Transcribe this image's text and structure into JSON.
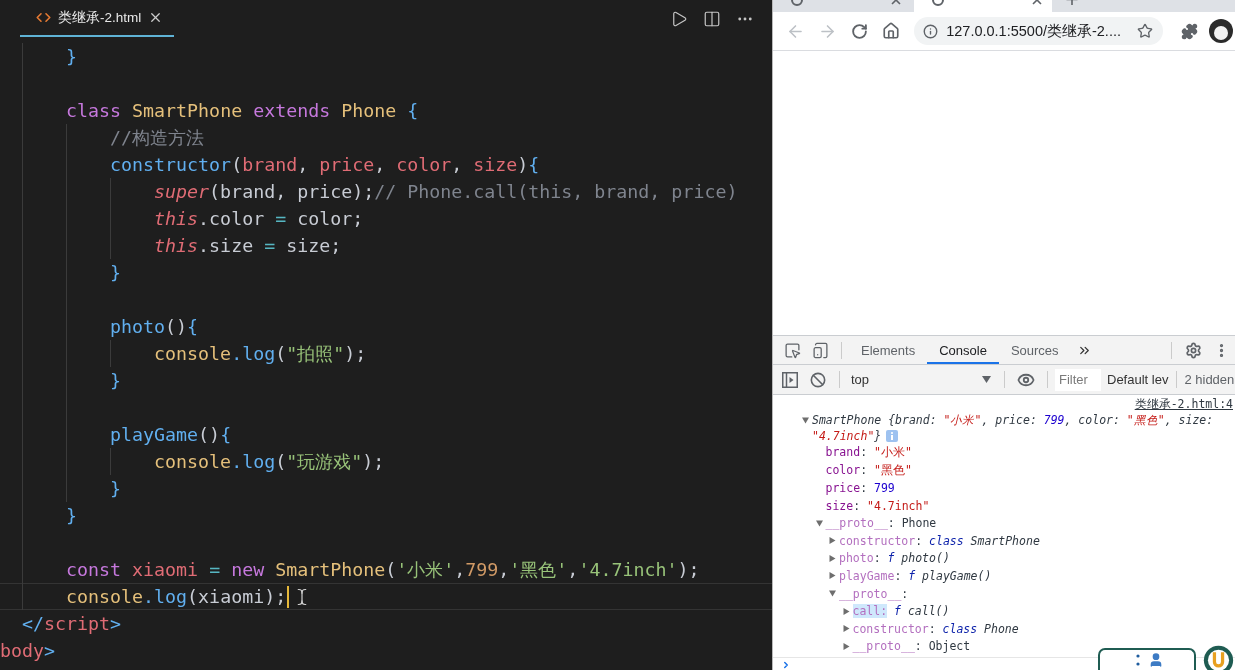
{
  "editor": {
    "tabs": [
      {
        "label": "类继承-2.html",
        "selected": true
      }
    ],
    "lines": [
      {
        "kind": "group",
        "children": [
          {
            "kind": "group",
            "children": [
              {
                "kind": "code",
                "cursor": false,
                "tokens": [
                  {
                    "kind": "bracket",
                    "text": "}"
                  }
                ]
              },
              {
                "kind": "blank",
                "cursor": false
              },
              {
                "kind": "code",
                "cursor": false,
                "tokens": [
                  {
                    "kind": "keyword",
                    "text": "class "
                  },
                  {
                    "kind": "class",
                    "text": "SmartPhone "
                  },
                  {
                    "kind": "keyword",
                    "text": "extends "
                  },
                  {
                    "kind": "class",
                    "text": "Phone "
                  },
                  {
                    "kind": "bracket",
                    "text": "{"
                  }
                ],
                "children": [
                  {
                    "kind": "code",
                    "cursor": false,
                    "tokens": [
                      {
                        "kind": "comment",
                        "text": "//构造方法"
                      }
                    ]
                  },
                  {
                    "kind": "code",
                    "cursor": false,
                    "tokens": [
                      {
                        "kind": "function",
                        "text": "constructor"
                      },
                      {
                        "kind": "plain",
                        "text": "("
                      },
                      {
                        "kind": "variable",
                        "text": "brand"
                      },
                      {
                        "kind": "plain",
                        "text": ", "
                      },
                      {
                        "kind": "variable",
                        "text": "price"
                      },
                      {
                        "kind": "plain",
                        "text": ", "
                      },
                      {
                        "kind": "variable",
                        "text": "color"
                      },
                      {
                        "kind": "plain",
                        "text": ", "
                      },
                      {
                        "kind": "variable",
                        "text": "size"
                      },
                      {
                        "kind": "plain",
                        "text": ")"
                      },
                      {
                        "kind": "bracket",
                        "text": "{"
                      }
                    ],
                    "children": [
                      {
                        "kind": "code",
                        "cursor": false,
                        "tokens": [
                          {
                            "kind": "builtin",
                            "text": "super"
                          },
                          {
                            "kind": "plain",
                            "text": "(brand, price);"
                          },
                          {
                            "kind": "comment",
                            "text": "// Phone.call(this, brand, price)"
                          }
                        ]
                      },
                      {
                        "kind": "code",
                        "cursor": false,
                        "tokens": [
                          {
                            "kind": "builtin",
                            "text": "this"
                          },
                          {
                            "kind": "plain",
                            "text": ".color "
                          },
                          {
                            "kind": "operator",
                            "text": "="
                          },
                          {
                            "kind": "plain",
                            "text": " color;"
                          }
                        ]
                      },
                      {
                        "kind": "code",
                        "cursor": false,
                        "tokens": [
                          {
                            "kind": "builtin",
                            "text": "this"
                          },
                          {
                            "kind": "plain",
                            "text": ".size "
                          },
                          {
                            "kind": "operator",
                            "text": "="
                          },
                          {
                            "kind": "plain",
                            "text": " size;"
                          }
                        ]
                      }
                    ]
                  },
                  {
                    "kind": "code",
                    "cursor": false,
                    "tokens": [
                      {
                        "kind": "bracket",
                        "text": "}"
                      }
                    ]
                  },
                  {
                    "kind": "blank",
                    "cursor": false
                  },
                  {
                    "kind": "code",
                    "cursor": false,
                    "tokens": [
                      {
                        "kind": "function",
                        "text": "photo"
                      },
                      {
                        "kind": "plain",
                        "text": "()"
                      },
                      {
                        "kind": "bracket",
                        "text": "{"
                      }
                    ],
                    "children": [
                      {
                        "kind": "code",
                        "cursor": false,
                        "tokens": [
                          {
                            "kind": "class",
                            "text": "console"
                          },
                          {
                            "kind": "function",
                            "text": ".log"
                          },
                          {
                            "kind": "plain",
                            "text": "("
                          },
                          {
                            "kind": "string",
                            "text": "\"拍照\""
                          },
                          {
                            "kind": "plain",
                            "text": ");"
                          }
                        ]
                      }
                    ]
                  },
                  {
                    "kind": "code",
                    "cursor": false,
                    "tokens": [
                      {
                        "kind": "bracket",
                        "text": "}"
                      }
                    ]
                  },
                  {
                    "kind": "blank",
                    "cursor": false
                  },
                  {
                    "kind": "code",
                    "cursor": false,
                    "tokens": [
                      {
                        "kind": "function",
                        "text": "playGame"
                      },
                      {
                        "kind": "plain",
                        "text": "()"
                      },
                      {
                        "kind": "bracket",
                        "text": "{"
                      }
                    ],
                    "children": [
                      {
                        "kind": "code",
                        "cursor": false,
                        "tokens": [
                          {
                            "kind": "class",
                            "text": "console"
                          },
                          {
                            "kind": "function",
                            "text": ".log"
                          },
                          {
                            "kind": "plain",
                            "text": "("
                          },
                          {
                            "kind": "string",
                            "text": "\"玩游戏\""
                          },
                          {
                            "kind": "plain",
                            "text": ");"
                          }
                        ]
                      }
                    ]
                  },
                  {
                    "kind": "code",
                    "cursor": false,
                    "tokens": [
                      {
                        "kind": "bracket",
                        "text": "}"
                      }
                    ]
                  }
                ]
              },
              {
                "kind": "code",
                "cursor": false,
                "tokens": [
                  {
                    "kind": "bracket",
                    "text": "}"
                  }
                ]
              },
              {
                "kind": "blank",
                "cursor": false
              },
              {
                "kind": "code",
                "cursor": false,
                "tokens": [
                  {
                    "kind": "keyword",
                    "text": "const "
                  },
                  {
                    "kind": "variable",
                    "text": "xiaomi"
                  },
                  {
                    "kind": "operator",
                    "text": " = "
                  },
                  {
                    "kind": "keyword",
                    "text": "new "
                  },
                  {
                    "kind": "class",
                    "text": "SmartPhone"
                  },
                  {
                    "kind": "plain",
                    "text": "("
                  },
                  {
                    "kind": "string",
                    "text": "'小米'"
                  },
                  {
                    "kind": "plain",
                    "text": ","
                  },
                  {
                    "kind": "number",
                    "text": "799"
                  },
                  {
                    "kind": "plain",
                    "text": ","
                  },
                  {
                    "kind": "string",
                    "text": "'黑色'"
                  },
                  {
                    "kind": "plain",
                    "text": ","
                  },
                  {
                    "kind": "string",
                    "text": "'4.7inch'"
                  },
                  {
                    "kind": "plain",
                    "text": ");"
                  }
                ]
              },
              {
                "kind": "code",
                "cursor": true,
                "tokens": [
                  {
                    "kind": "class",
                    "text": "console"
                  },
                  {
                    "kind": "function",
                    "text": ".log"
                  },
                  {
                    "kind": "plain",
                    "text": "(xiaomi);"
                  }
                ]
              }
            ]
          },
          {
            "kind": "code",
            "cursor": false,
            "tokens": [
              {
                "kind": "tag-punct",
                "text": "</"
              },
              {
                "kind": "tag",
                "text": "script"
              },
              {
                "kind": "tag-punct",
                "text": ">"
              }
            ]
          }
        ]
      },
      {
        "kind": "code",
        "cursor": false,
        "tokens": [
          {
            "kind": "tag",
            "text": "body"
          },
          {
            "kind": "tag-punct",
            "text": ">"
          }
        ]
      }
    ]
  },
  "browser": {
    "tabs": [
      {
        "selected": false
      },
      {
        "selected": true
      }
    ],
    "back_button": {
      "disabled": true
    },
    "forward_button": {
      "disabled": true
    },
    "address": "127.0.0.1:5500/类继承-2...."
  },
  "devtools": {
    "tabs": [
      {
        "label": "Elements",
        "selected": false
      },
      {
        "label": "Console",
        "selected": true
      },
      {
        "label": "Sources",
        "selected": false
      }
    ],
    "context": "top",
    "filter": {
      "placeholder": "Filter"
    },
    "levels": "Default lev",
    "hidden": "2 hidden",
    "console": {
      "source_link": "类继承-2.html:4",
      "tree": {
        "kind": "branch",
        "expanded": true,
        "summary_lines": [
          [
            {
              "kind": "plain",
              "text": "SmartPhone {brand: "
            },
            {
              "kind": "string",
              "text": "\"小米\""
            },
            {
              "kind": "plain",
              "text": ", price: "
            },
            {
              "kind": "number",
              "text": "799"
            },
            {
              "kind": "plain",
              "text": ", color: "
            },
            {
              "kind": "string",
              "text": "\"黑色\""
            },
            {
              "kind": "plain",
              "text": ", size:"
            }
          ],
          [
            {
              "kind": "string",
              "text": "\"4.7inch\""
            },
            {
              "kind": "plain",
              "text": "}"
            }
          ]
        ],
        "children": [
          {
            "kind": "leaf",
            "tokens": [
              {
                "kind": "key",
                "text": "brand"
              },
              {
                "kind": "plain",
                "text": ": "
              },
              {
                "kind": "string",
                "text": "\"小米\""
              }
            ]
          },
          {
            "kind": "leaf",
            "tokens": [
              {
                "kind": "key",
                "text": "color"
              },
              {
                "kind": "plain",
                "text": ": "
              },
              {
                "kind": "string",
                "text": "\"黑色\""
              }
            ]
          },
          {
            "kind": "leaf",
            "tokens": [
              {
                "kind": "key",
                "text": "price"
              },
              {
                "kind": "plain",
                "text": ": "
              },
              {
                "kind": "number",
                "text": "799"
              }
            ]
          },
          {
            "kind": "leaf",
            "tokens": [
              {
                "kind": "key",
                "text": "size"
              },
              {
                "kind": "plain",
                "text": ": "
              },
              {
                "kind": "string",
                "text": "\"4.7inch\""
              }
            ]
          },
          {
            "kind": "branch",
            "expanded": true,
            "tokens": [
              {
                "kind": "proto-key",
                "text": "__proto__"
              },
              {
                "kind": "plain",
                "text": ": Phone"
              }
            ],
            "children": [
              {
                "kind": "branch",
                "expanded": false,
                "tokens": [
                  {
                    "kind": "proto-key",
                    "text": "constructor"
                  },
                  {
                    "kind": "plain",
                    "text": ": "
                  },
                  {
                    "kind": "keyword",
                    "text": "class"
                  },
                  {
                    "kind": "italic",
                    "text": " SmartPhone"
                  }
                ]
              },
              {
                "kind": "branch",
                "expanded": false,
                "tokens": [
                  {
                    "kind": "proto-key",
                    "text": "photo"
                  },
                  {
                    "kind": "plain",
                    "text": ": "
                  },
                  {
                    "kind": "keyword",
                    "text": "f"
                  },
                  {
                    "kind": "italic",
                    "text": " photo()"
                  }
                ]
              },
              {
                "kind": "branch",
                "expanded": false,
                "tokens": [
                  {
                    "kind": "proto-key",
                    "text": "playGame"
                  },
                  {
                    "kind": "plain",
                    "text": ": "
                  },
                  {
                    "kind": "keyword",
                    "text": "f"
                  },
                  {
                    "kind": "italic",
                    "text": " playGame()"
                  }
                ]
              },
              {
                "kind": "branch",
                "expanded": true,
                "tokens": [
                  {
                    "kind": "proto-key",
                    "text": "__proto__"
                  },
                  {
                    "kind": "plain",
                    "text": ":"
                  }
                ],
                "children": [
                  {
                    "kind": "branch",
                    "expanded": false,
                    "tokens": [
                      {
                        "kind": "match-key",
                        "text": "call:"
                      },
                      {
                        "kind": "keyword",
                        "text": " f"
                      },
                      {
                        "kind": "italic",
                        "text": " call()"
                      }
                    ]
                  },
                  {
                    "kind": "branch",
                    "expanded": false,
                    "tokens": [
                      {
                        "kind": "proto-key",
                        "text": "constructor"
                      },
                      {
                        "kind": "plain",
                        "text": ": "
                      },
                      {
                        "kind": "keyword",
                        "text": "class"
                      },
                      {
                        "kind": "italic",
                        "text": " Phone"
                      }
                    ]
                  },
                  {
                    "kind": "branch",
                    "expanded": false,
                    "tokens": [
                      {
                        "kind": "proto-key",
                        "text": "__proto__"
                      },
                      {
                        "kind": "plain",
                        "text": ": Object"
                      }
                    ]
                  }
                ]
              }
            ]
          }
        ]
      }
    }
  }
}
